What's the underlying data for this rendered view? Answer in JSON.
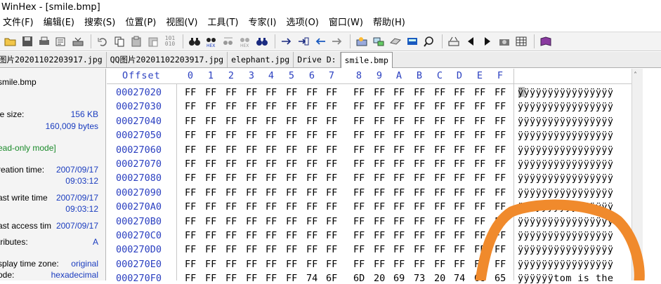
{
  "window": {
    "title": "WinHex - [smile.bmp]"
  },
  "menu": [
    "文件(F)",
    "编辑(E)",
    "搜索(S)",
    "位置(P)",
    "视图(V)",
    "工具(T)",
    "专家(I)",
    "选项(O)",
    "窗口(W)",
    "帮助(H)"
  ],
  "tabs": [
    {
      "label": "图片20201102203917.jpg",
      "active": false
    },
    {
      "label": "QQ图片20201102203917.jpg",
      "active": false
    },
    {
      "label": "elephant.jpg",
      "active": false
    },
    {
      "label": "Drive D:",
      "active": false
    },
    {
      "label": "smile.bmp",
      "active": true
    }
  ],
  "sidebar": {
    "filename": "smile.bmp",
    "size_label": "le size:",
    "size_kb": "156 KB",
    "size_bytes": "160,009 bytes",
    "mode": "ead-only mode]",
    "creation_label": "reation time:",
    "creation_date": "2007/09/17",
    "creation_time": "09:03:12",
    "write_label": "ast write time",
    "write_date": "2007/09/17",
    "write_time": "09:03:12",
    "access_label": "ast access tim",
    "access_date": "2007/09/17",
    "attr_label": "tributes:",
    "attr_value": "A",
    "tz_label": "splay time zone:",
    "tz_value": "original",
    "mode2_label": "ode:",
    "mode2_value": "hexadecimal"
  },
  "hex": {
    "offset_header": "Offset",
    "columns": [
      "0",
      "1",
      "2",
      "3",
      "4",
      "5",
      "6",
      "7",
      "8",
      "9",
      "A",
      "B",
      "C",
      "D",
      "E",
      "F"
    ],
    "rows": [
      {
        "offset": "00027020",
        "bytes": [
          "FF",
          "FF",
          "FF",
          "FF",
          "FF",
          "FF",
          "FF",
          "FF",
          "FF",
          "FF",
          "FF",
          "FF",
          "FF",
          "FF",
          "FF",
          "FF"
        ],
        "text": "ÿÿÿÿÿÿÿÿÿÿÿÿÿÿÿÿ"
      },
      {
        "offset": "00027030",
        "bytes": [
          "FF",
          "FF",
          "FF",
          "FF",
          "FF",
          "FF",
          "FF",
          "FF",
          "FF",
          "FF",
          "FF",
          "FF",
          "FF",
          "FF",
          "FF",
          "FF"
        ],
        "text": "ÿÿÿÿÿÿÿÿÿÿÿÿÿÿÿÿ"
      },
      {
        "offset": "00027040",
        "bytes": [
          "FF",
          "FF",
          "FF",
          "FF",
          "FF",
          "FF",
          "FF",
          "FF",
          "FF",
          "FF",
          "FF",
          "FF",
          "FF",
          "FF",
          "FF",
          "FF"
        ],
        "text": "ÿÿÿÿÿÿÿÿÿÿÿÿÿÿÿÿ"
      },
      {
        "offset": "00027050",
        "bytes": [
          "FF",
          "FF",
          "FF",
          "FF",
          "FF",
          "FF",
          "FF",
          "FF",
          "FF",
          "FF",
          "FF",
          "FF",
          "FF",
          "FF",
          "FF",
          "FF"
        ],
        "text": "ÿÿÿÿÿÿÿÿÿÿÿÿÿÿÿÿ"
      },
      {
        "offset": "00027060",
        "bytes": [
          "FF",
          "FF",
          "FF",
          "FF",
          "FF",
          "FF",
          "FF",
          "FF",
          "FF",
          "FF",
          "FF",
          "FF",
          "FF",
          "FF",
          "FF",
          "FF"
        ],
        "text": "ÿÿÿÿÿÿÿÿÿÿÿÿÿÿÿÿ"
      },
      {
        "offset": "00027070",
        "bytes": [
          "FF",
          "FF",
          "FF",
          "FF",
          "FF",
          "FF",
          "FF",
          "FF",
          "FF",
          "FF",
          "FF",
          "FF",
          "FF",
          "FF",
          "FF",
          "FF"
        ],
        "text": "ÿÿÿÿÿÿÿÿÿÿÿÿÿÿÿÿ"
      },
      {
        "offset": "00027080",
        "bytes": [
          "FF",
          "FF",
          "FF",
          "FF",
          "FF",
          "FF",
          "FF",
          "FF",
          "FF",
          "FF",
          "FF",
          "FF",
          "FF",
          "FF",
          "FF",
          "FF"
        ],
        "text": "ÿÿÿÿÿÿÿÿÿÿÿÿÿÿÿÿ"
      },
      {
        "offset": "00027090",
        "bytes": [
          "FF",
          "FF",
          "FF",
          "FF",
          "FF",
          "FF",
          "FF",
          "FF",
          "FF",
          "FF",
          "FF",
          "FF",
          "FF",
          "FF",
          "FF",
          "FF"
        ],
        "text": "ÿÿÿÿÿÿÿÿÿÿÿÿÿÿÿÿ"
      },
      {
        "offset": "000270A0",
        "bytes": [
          "FF",
          "FF",
          "FF",
          "FF",
          "FF",
          "FF",
          "FF",
          "FF",
          "FF",
          "FF",
          "FF",
          "FF",
          "FF",
          "FF",
          "FF",
          "FF"
        ],
        "text": "ÿÿÿÿÿÿÿÿÿÿÿÿÿÿÿÿ"
      },
      {
        "offset": "000270B0",
        "bytes": [
          "FF",
          "FF",
          "FF",
          "FF",
          "FF",
          "FF",
          "FF",
          "FF",
          "FF",
          "FF",
          "FF",
          "FF",
          "FF",
          "FF",
          "FF",
          "FF"
        ],
        "text": "ÿÿÿÿÿÿÿÿÿÿÿÿÿÿÿÿ"
      },
      {
        "offset": "000270C0",
        "bytes": [
          "FF",
          "FF",
          "FF",
          "FF",
          "FF",
          "FF",
          "FF",
          "FF",
          "FF",
          "FF",
          "FF",
          "FF",
          "FF",
          "FF",
          "FF",
          "FF"
        ],
        "text": "ÿÿÿÿÿÿÿÿÿÿÿÿÿÿÿÿ"
      },
      {
        "offset": "000270D0",
        "bytes": [
          "FF",
          "FF",
          "FF",
          "FF",
          "FF",
          "FF",
          "FF",
          "FF",
          "FF",
          "FF",
          "FF",
          "FF",
          "FF",
          "FF",
          "FF",
          "FF"
        ],
        "text": "ÿÿÿÿÿÿÿÿÿÿÿÿÿÿÿÿ"
      },
      {
        "offset": "000270E0",
        "bytes": [
          "FF",
          "FF",
          "FF",
          "FF",
          "FF",
          "FF",
          "FF",
          "FF",
          "FF",
          "FF",
          "FF",
          "FF",
          "FF",
          "FF",
          "FF",
          "FF"
        ],
        "text": "ÿÿÿÿÿÿÿÿÿÿÿÿÿÿÿÿ"
      },
      {
        "offset": "000270F0",
        "bytes": [
          "FF",
          "FF",
          "FF",
          "FF",
          "FF",
          "FF",
          "74",
          "6F",
          "6D",
          "20",
          "69",
          "73",
          "20",
          "74",
          "68",
          "65"
        ],
        "text": "ÿÿÿÿÿÿtom is the"
      }
    ]
  },
  "colors": {
    "offset_blue": "#2a3fc0",
    "value_blue": "#1a3cbf",
    "mode_green": "#1a8a2a",
    "annotation_orange": "#f08a2c"
  },
  "icons": [
    "open-folder-icon",
    "save-icon",
    "print-icon",
    "properties-icon",
    "open-disk-icon",
    "undo-icon",
    "copy-icon",
    "paste-icon",
    "paste-special-icon",
    "binary-icon",
    "find-icon",
    "find-hex-icon",
    "replace-icon",
    "replace-hex-icon",
    "find-again-icon",
    "goto-offset-icon",
    "goto-sector-icon",
    "back-icon",
    "forward-icon",
    "disk-editor-icon",
    "ram-editor-icon",
    "drive-icon",
    "calculator-icon",
    "search-analysis-icon",
    "tools-icon",
    "prev-icon",
    "next-icon",
    "camera-icon",
    "table-icon",
    "book-icon"
  ]
}
